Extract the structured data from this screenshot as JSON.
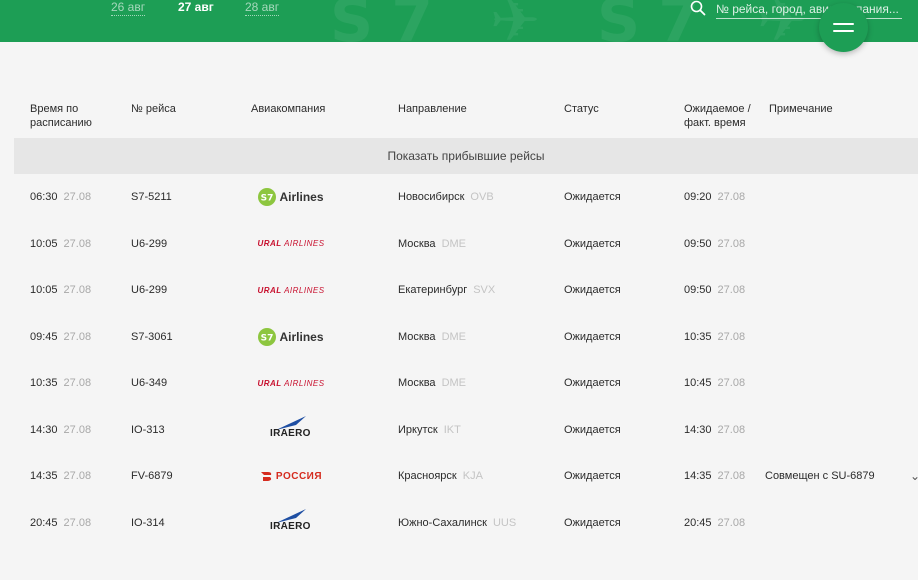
{
  "header": {
    "dates": [
      "26 авг",
      "27 авг",
      "28 авг"
    ],
    "active_date_index": 1,
    "search_placeholder": "№ рейса, город, авиакомпания..."
  },
  "table": {
    "columns": {
      "scheduled": "Время по расписанию",
      "flight": "№ рейса",
      "airline": "Авиакомпания",
      "direction": "Направление",
      "status": "Статус",
      "expected": "Ожидаемое / факт. время",
      "note": "Примечание"
    },
    "show_arrived_label": "Показать прибывшие рейсы",
    "rows": [
      {
        "time": "06:30",
        "date": "27.08",
        "flight": "S7-5211",
        "airline": "s7",
        "city": "Новосибирск",
        "code": "OVB",
        "status": "Ожидается",
        "exp_time": "09:20",
        "exp_date": "27.08",
        "note": ""
      },
      {
        "time": "10:05",
        "date": "27.08",
        "flight": "U6-299",
        "airline": "ural",
        "city": "Москва",
        "code": "DME",
        "status": "Ожидается",
        "exp_time": "09:50",
        "exp_date": "27.08",
        "note": ""
      },
      {
        "time": "10:05",
        "date": "27.08",
        "flight": "U6-299",
        "airline": "ural",
        "city": "Екатеринбург",
        "code": "SVX",
        "status": "Ожидается",
        "exp_time": "09:50",
        "exp_date": "27.08",
        "note": ""
      },
      {
        "time": "09:45",
        "date": "27.08",
        "flight": "S7-3061",
        "airline": "s7",
        "city": "Москва",
        "code": "DME",
        "status": "Ожидается",
        "exp_time": "10:35",
        "exp_date": "27.08",
        "note": ""
      },
      {
        "time": "10:35",
        "date": "27.08",
        "flight": "U6-349",
        "airline": "ural",
        "city": "Москва",
        "code": "DME",
        "status": "Ожидается",
        "exp_time": "10:45",
        "exp_date": "27.08",
        "note": ""
      },
      {
        "time": "14:30",
        "date": "27.08",
        "flight": "IO-313",
        "airline": "iraero",
        "city": "Иркутск",
        "code": "IKT",
        "status": "Ожидается",
        "exp_time": "14:30",
        "exp_date": "27.08",
        "note": ""
      },
      {
        "time": "14:35",
        "date": "27.08",
        "flight": "FV-6879",
        "airline": "rossiya",
        "city": "Красноярск",
        "code": "KJA",
        "status": "Ожидается",
        "exp_time": "14:35",
        "exp_date": "27.08",
        "note": "Совмещен с SU-6879"
      },
      {
        "time": "20:45",
        "date": "27.08",
        "flight": "IO-314",
        "airline": "iraero",
        "city": "Южно-Сахалинск",
        "code": "UUS",
        "status": "Ожидается",
        "exp_time": "20:45",
        "exp_date": "27.08",
        "note": ""
      }
    ]
  },
  "airlines": {
    "s7": {
      "label": "Airlines",
      "mark": "S7",
      "color": "#8dc63f"
    },
    "ural": {
      "label_bold": "URAL",
      "label_rest": "AIRLINES",
      "color": "#c8102e"
    },
    "rossiya": {
      "label": "РОССИЯ",
      "color": "#d52b1e"
    },
    "iraero": {
      "label": "IRAERO",
      "color": "#1f4fa3"
    }
  },
  "colors": {
    "brand_green": "#1d9e55"
  }
}
